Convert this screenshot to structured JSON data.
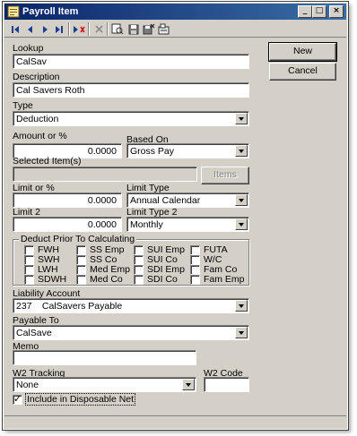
{
  "window": {
    "title": "Payroll Item"
  },
  "titlebar_buttons": {
    "minimize": "_",
    "maximize": "□",
    "close": "×"
  },
  "toolbar": {
    "icons": [
      "first-record-icon",
      "previous-record-icon",
      "next-record-icon",
      "last-record-icon",
      "new-record-icon",
      "delete-icon",
      "find-icon",
      "save-icon",
      "save-close-icon",
      "setup-icon"
    ]
  },
  "form": {
    "lookup_label": "Lookup",
    "lookup_value": "CalSav",
    "description_label": "Description",
    "description_value": "Cal Savers Roth",
    "type_label": "Type",
    "type_value": "Deduction",
    "amount_label": "Amount or %",
    "amount_value": "0.0000",
    "based_on_label": "Based On",
    "based_on_value": "Gross Pay",
    "selected_items_label": "Selected Item(s)",
    "selected_items_value": "",
    "items_button": "Items",
    "limit_label": "Limit or %",
    "limit_value": "0.0000",
    "limit_type_label": "Limit Type",
    "limit_type_value": "Annual Calendar",
    "limit2_label": "Limit 2",
    "limit2_value": "0.0000",
    "limit_type2_label": "Limit Type 2",
    "limit_type2_value": "Monthly",
    "deduct_group_title": "Deduct Prior To Calculating",
    "deduct_items": [
      {
        "label": "FWH",
        "checked": false
      },
      {
        "label": "SS Emp",
        "checked": false
      },
      {
        "label": "SUI Emp",
        "checked": false
      },
      {
        "label": "FUTA",
        "checked": false
      },
      {
        "label": "SWH",
        "checked": false
      },
      {
        "label": "SS Co",
        "checked": false
      },
      {
        "label": "SUI Co",
        "checked": false
      },
      {
        "label": "W/C",
        "checked": false
      },
      {
        "label": "LWH",
        "checked": false
      },
      {
        "label": "Med Emp",
        "checked": false
      },
      {
        "label": "SDI Emp",
        "checked": false
      },
      {
        "label": "Fam Co",
        "checked": false
      },
      {
        "label": "SDWH",
        "checked": false
      },
      {
        "label": "Med Co",
        "checked": false
      },
      {
        "label": "SDI Co",
        "checked": false
      },
      {
        "label": "Fam Emp",
        "checked": false
      }
    ],
    "liability_label": "Liability Account",
    "liability_number": "237",
    "liability_name": "CalSavers Payable",
    "payable_label": "Payable To",
    "payable_value": "CalSave",
    "memo_label": "Memo",
    "memo_value": "",
    "w2_tracking_label": "W2 Tracking",
    "w2_tracking_value": "None",
    "w2_code_label": "W2 Code",
    "w2_code_value": "",
    "disposable_label": "Include in Disposable Net",
    "disposable_checked": true
  },
  "buttons": {
    "new": "New",
    "cancel": "Cancel"
  }
}
